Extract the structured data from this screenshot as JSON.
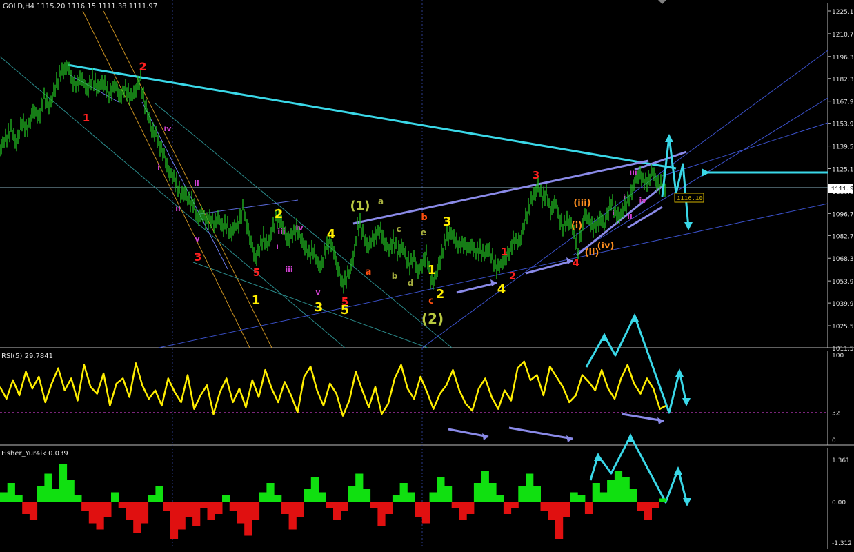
{
  "chart_data": [
    {
      "type": "candlestick",
      "title": "GOLD,H4  1115.20 1116.15 1111.38 1111.97",
      "symbol": "GOLD",
      "timeframe": "H4",
      "ohlc": {
        "open": 1115.2,
        "high": 1116.15,
        "low": 1111.38,
        "close": 1111.97
      },
      "ylim": [
        1011.5,
        1225.1
      ],
      "ytick_labels": [
        "1225.1",
        "1210.7",
        "1196.3",
        "1182.3",
        "1167.9",
        "1153.9",
        "1139.5",
        "1125.1",
        "1110.8",
        "1096.7",
        "1082.7",
        "1068.3",
        "1053.9",
        "1039.9",
        "1025.5",
        "1011.5"
      ],
      "current_price_label": "1111.9",
      "price_marker_label": "1116.10",
      "price_path": [
        [
          0,
          1138
        ],
        [
          8,
          1144
        ],
        [
          16,
          1150
        ],
        [
          24,
          1141
        ],
        [
          32,
          1155
        ],
        [
          40,
          1150
        ],
        [
          48,
          1162
        ],
        [
          56,
          1158
        ],
        [
          64,
          1170
        ],
        [
          72,
          1164
        ],
        [
          80,
          1177
        ],
        [
          86,
          1184
        ],
        [
          92,
          1188
        ],
        [
          98,
          1190
        ],
        [
          104,
          1182
        ],
        [
          110,
          1178
        ],
        [
          118,
          1183
        ],
        [
          126,
          1175
        ],
        [
          134,
          1182
        ],
        [
          142,
          1176
        ],
        [
          150,
          1180
        ],
        [
          158,
          1172
        ],
        [
          166,
          1178
        ],
        [
          174,
          1171
        ],
        [
          182,
          1176
        ],
        [
          190,
          1170
        ],
        [
          198,
          1176
        ],
        [
          204,
          1182
        ],
        [
          208,
          1170
        ],
        [
          214,
          1160
        ],
        [
          220,
          1150
        ],
        [
          226,
          1146
        ],
        [
          232,
          1140
        ],
        [
          238,
          1133
        ],
        [
          244,
          1124
        ],
        [
          250,
          1120
        ],
        [
          256,
          1116
        ],
        [
          262,
          1108
        ],
        [
          268,
          1110
        ],
        [
          274,
          1104
        ],
        [
          280,
          1104
        ],
        [
          286,
          1093
        ],
        [
          292,
          1097
        ],
        [
          298,
          1092
        ],
        [
          304,
          1094
        ],
        [
          310,
          1090
        ],
        [
          316,
          1094
        ],
        [
          322,
          1088
        ],
        [
          328,
          1090
        ],
        [
          334,
          1084
        ],
        [
          340,
          1088
        ],
        [
          346,
          1090
        ],
        [
          352,
          1100
        ],
        [
          358,
          1090
        ],
        [
          364,
          1078
        ],
        [
          370,
          1068
        ],
        [
          376,
          1074
        ],
        [
          382,
          1082
        ],
        [
          388,
          1076
        ],
        [
          394,
          1086
        ],
        [
          400,
          1092
        ],
        [
          406,
          1094
        ],
        [
          412,
          1085
        ],
        [
          418,
          1080
        ],
        [
          424,
          1083
        ],
        [
          430,
          1088
        ],
        [
          436,
          1081
        ],
        [
          442,
          1076
        ],
        [
          448,
          1070
        ],
        [
          454,
          1074
        ],
        [
          460,
          1065
        ],
        [
          466,
          1064
        ],
        [
          472,
          1074
        ],
        [
          478,
          1080
        ],
        [
          484,
          1072
        ],
        [
          490,
          1062
        ],
        [
          496,
          1052
        ],
        [
          502,
          1055
        ],
        [
          508,
          1062
        ],
        [
          514,
          1072
        ],
        [
          518,
          1088
        ],
        [
          522,
          1090
        ],
        [
          528,
          1080
        ],
        [
          534,
          1076
        ],
        [
          540,
          1080
        ],
        [
          546,
          1084
        ],
        [
          552,
          1086
        ],
        [
          558,
          1078
        ],
        [
          564,
          1074
        ],
        [
          570,
          1080
        ],
        [
          576,
          1072
        ],
        [
          582,
          1076
        ],
        [
          588,
          1070
        ],
        [
          594,
          1064
        ],
        [
          600,
          1068
        ],
        [
          606,
          1060
        ],
        [
          612,
          1064
        ],
        [
          618,
          1072
        ],
        [
          624,
          1055
        ],
        [
          630,
          1054
        ],
        [
          636,
          1064
        ],
        [
          642,
          1074
        ],
        [
          648,
          1082
        ],
        [
          654,
          1084
        ],
        [
          660,
          1080
        ],
        [
          666,
          1076
        ],
        [
          672,
          1078
        ],
        [
          678,
          1074
        ],
        [
          684,
          1077
        ],
        [
          690,
          1072
        ],
        [
          696,
          1074
        ],
        [
          702,
          1070
        ],
        [
          708,
          1075
        ],
        [
          714,
          1068
        ],
        [
          720,
          1062
        ],
        [
          726,
          1064
        ],
        [
          732,
          1068
        ],
        [
          738,
          1072
        ],
        [
          744,
          1080
        ],
        [
          750,
          1078
        ],
        [
          756,
          1082
        ],
        [
          762,
          1094
        ],
        [
          768,
          1102
        ],
        [
          774,
          1108
        ],
        [
          780,
          1114
        ],
        [
          786,
          1106
        ],
        [
          792,
          1110
        ],
        [
          798,
          1098
        ],
        [
          804,
          1104
        ],
        [
          810,
          1096
        ],
        [
          816,
          1088
        ],
        [
          822,
          1092
        ],
        [
          828,
          1090
        ],
        [
          834,
          1080
        ],
        [
          838,
          1074
        ],
        [
          842,
          1084
        ],
        [
          848,
          1096
        ],
        [
          854,
          1092
        ],
        [
          860,
          1088
        ],
        [
          866,
          1090
        ],
        [
          872,
          1094
        ],
        [
          876,
          1088
        ],
        [
          880,
          1096
        ],
        [
          886,
          1104
        ],
        [
          892,
          1098
        ],
        [
          898,
          1094
        ],
        [
          904,
          1100
        ],
        [
          910,
          1104
        ],
        [
          916,
          1112
        ],
        [
          922,
          1118
        ],
        [
          928,
          1122
        ],
        [
          934,
          1116
        ],
        [
          940,
          1118
        ],
        [
          946,
          1124
        ],
        [
          950,
          1118
        ],
        [
          956,
          1114
        ],
        [
          962,
          1116
        ],
        [
          966,
          1112
        ]
      ],
      "wave_labels": [
        {
          "text": "1",
          "color": "#ff2020"
        },
        {
          "text": "2",
          "color": "#ff2020"
        },
        {
          "text": "3",
          "color": "#ff2020"
        },
        {
          "text": "5",
          "color": "#ff2020"
        },
        {
          "text": "5",
          "color": "#ff2020"
        },
        {
          "text": "1",
          "color": "#ff2020"
        },
        {
          "text": "2",
          "color": "#ff2020"
        },
        {
          "text": "3",
          "color": "#ff2020"
        },
        {
          "text": "4",
          "color": "#ff2020"
        },
        {
          "text": "i",
          "color": "#d040d0"
        },
        {
          "text": "ii",
          "color": "#d040d0"
        },
        {
          "text": "iii",
          "color": "#d040d0"
        },
        {
          "text": "iv",
          "color": "#d040d0"
        },
        {
          "text": "v",
          "color": "#d040d0"
        },
        {
          "text": "ii",
          "color": "#d040d0"
        },
        {
          "text": "i",
          "color": "#d040d0"
        },
        {
          "text": "iii",
          "color": "#d040d0"
        },
        {
          "text": "iv",
          "color": "#d040d0"
        },
        {
          "text": "v",
          "color": "#d040d0"
        },
        {
          "text": "i",
          "color": "#d040d0"
        },
        {
          "text": "iii",
          "color": "#d040d0"
        },
        {
          "text": "iv",
          "color": "#d040d0"
        },
        {
          "text": "ii",
          "color": "#d040d0"
        },
        {
          "text": "i",
          "color": "#d040d0"
        },
        {
          "text": "2",
          "color": "#ffee00"
        },
        {
          "text": "4",
          "color": "#ffee00"
        },
        {
          "text": "1",
          "color": "#ffee00"
        },
        {
          "text": "3",
          "color": "#ffee00"
        },
        {
          "text": "5",
          "color": "#ffee00"
        },
        {
          "text": "3",
          "color": "#ffee00"
        },
        {
          "text": "1",
          "color": "#ffee00"
        },
        {
          "text": "2",
          "color": "#ffee00"
        },
        {
          "text": "4",
          "color": "#ffee00"
        },
        {
          "text": "(1)",
          "color": "#b8c840"
        },
        {
          "text": "(2)",
          "color": "#b8c840"
        },
        {
          "text": "a",
          "color": "#a8b040"
        },
        {
          "text": "c",
          "color": "#a8b040"
        },
        {
          "text": "e",
          "color": "#a8b040"
        },
        {
          "text": "b",
          "color": "#a8b040"
        },
        {
          "text": "d",
          "color": "#a8b040"
        },
        {
          "text": "a",
          "color": "#ff5010"
        },
        {
          "text": "b",
          "color": "#ff5010"
        },
        {
          "text": "c",
          "color": "#ff5010"
        },
        {
          "text": "(iii)",
          "color": "#ff9020"
        },
        {
          "text": "(i)",
          "color": "#ff9020"
        },
        {
          "text": "(iv)",
          "color": "#ff9020"
        },
        {
          "text": "(ii)",
          "color": "#ff9020"
        }
      ]
    },
    {
      "type": "line",
      "title": "RSI(5) 29.7841",
      "ylim": [
        0,
        100
      ],
      "ytick_labels": [
        "100",
        "32",
        "0"
      ],
      "level": 32,
      "values": [
        62,
        48,
        70,
        52,
        80,
        60,
        74,
        44,
        66,
        84,
        58,
        72,
        46,
        88,
        62,
        54,
        78,
        40,
        66,
        72,
        50,
        90,
        64,
        48,
        58,
        40,
        72,
        56,
        44,
        76,
        36,
        52,
        64,
        30,
        56,
        72,
        44,
        60,
        38,
        70,
        50,
        82,
        60,
        44,
        68,
        52,
        32,
        74,
        86,
        58,
        40,
        66,
        54,
        28,
        46,
        80,
        58,
        38,
        62,
        30,
        42,
        72,
        88,
        60,
        48,
        74,
        56,
        36,
        54,
        64,
        82,
        58,
        42,
        34,
        60,
        72,
        50,
        36,
        58,
        46,
        84,
        92,
        70,
        76,
        52,
        86,
        74,
        62,
        44,
        52,
        76,
        68,
        58,
        82,
        60,
        48,
        72,
        88,
        66,
        54,
        72,
        60,
        36,
        40
      ]
    },
    {
      "type": "bar",
      "title": "Fisher_Yur4ik 0.039",
      "ylim": [
        -1.312,
        1.361
      ],
      "ytick_labels": [
        "1.361",
        "0.00",
        "-1.312"
      ],
      "values": [
        0.3,
        0.6,
        0.2,
        -0.4,
        -0.6,
        0.5,
        0.9,
        0.4,
        1.2,
        0.7,
        0.2,
        -0.3,
        -0.7,
        -0.9,
        -0.5,
        0.3,
        -0.2,
        -0.6,
        -1.0,
        -0.7,
        0.2,
        0.5,
        -0.3,
        -1.2,
        -0.9,
        -0.5,
        -0.8,
        -0.2,
        -0.6,
        -0.4,
        0.2,
        -0.3,
        -0.7,
        -1.1,
        -0.6,
        0.3,
        0.6,
        0.2,
        -0.4,
        -0.9,
        -0.5,
        0.4,
        0.8,
        0.3,
        -0.2,
        -0.6,
        -0.3,
        0.5,
        0.9,
        0.4,
        -0.2,
        -0.8,
        -0.4,
        0.2,
        0.6,
        0.3,
        -0.5,
        -0.7,
        0.3,
        0.8,
        0.5,
        -0.2,
        -0.6,
        -0.4,
        0.6,
        1.0,
        0.6,
        0.2,
        -0.4,
        -0.2,
        0.5,
        0.9,
        0.5,
        -0.3,
        -0.6,
        -1.2,
        -0.5,
        0.3,
        0.2,
        -0.4,
        0.6,
        0.3,
        0.7,
        1.0,
        0.8,
        0.4,
        -0.3,
        -0.6,
        -0.2,
        0.1
      ]
    }
  ]
}
